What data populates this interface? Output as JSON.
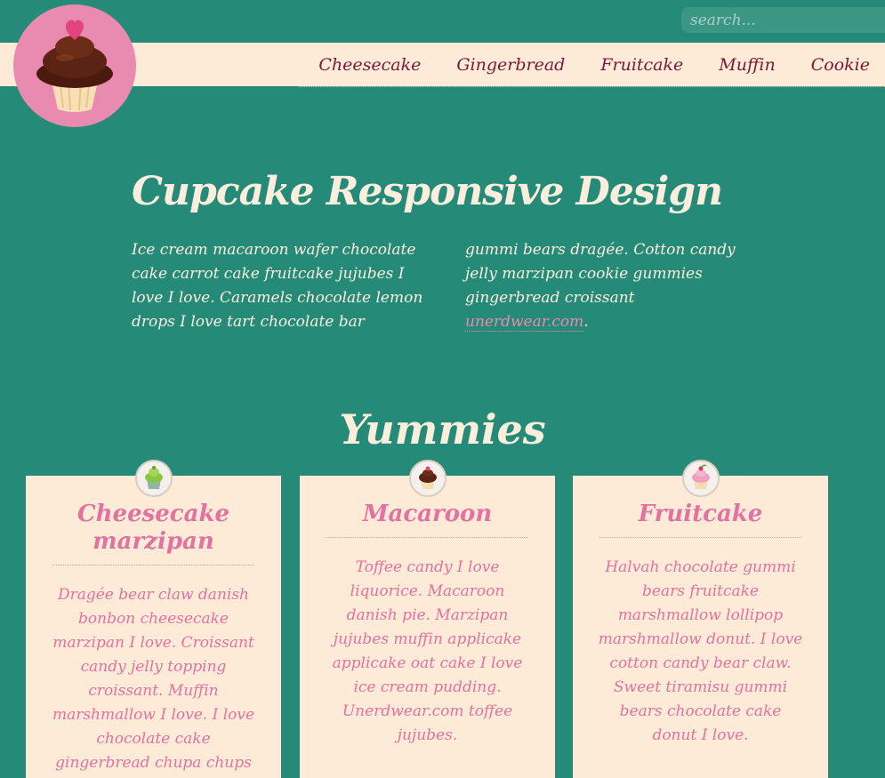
{
  "search": {
    "placeholder": "search..."
  },
  "nav": {
    "items": [
      "Cheesecake",
      "Gingerbread",
      "Fruitcake",
      "Muffin",
      "Cookie"
    ]
  },
  "hero": {
    "title": "Cupcake Responsive Design",
    "col1": "Ice cream macaroon wafer chocolate cake carrot cake fruitcake jujubes I love I love. Caramels chocolate lemon drops I love tart chocolate bar",
    "col2": "gummi bears dragée. Cotton candy jelly marzipan cookie gummies gingerbread croissant",
    "link": "unerdwear.com",
    "period": "."
  },
  "section": {
    "title": "Yummies"
  },
  "cards": [
    {
      "title": "Cheesecake marzipan",
      "text": "Dragée bear claw danish bonbon cheesecake marzipan I love. Croissant candy jelly topping croissant. Muffin marshmallow I love. I love chocolate cake gingerbread chupa chups",
      "icon": "green-cupcake-icon"
    },
    {
      "title": "Macaroon",
      "text": "Toffee candy I love liquorice. Macaroon danish pie. Marzipan jujubes muffin applicake applicake oat cake I love ice cream pudding. Unerdwear.com toffee jujubes.",
      "icon": "chocolate-cupcake-icon"
    },
    {
      "title": "Fruitcake",
      "text": "Halvah chocolate gummi bears fruitcake marshmallow lollipop marshmallow donut. I love cotton candy bear claw. Sweet tiramisu gummi bears chocolate cake donut I love.",
      "icon": "pink-cupcake-icon"
    }
  ],
  "colors": {
    "background": "#258a77",
    "cream": "#fdebd8",
    "pink": "#e2729f",
    "nav_text": "#7a1838"
  }
}
